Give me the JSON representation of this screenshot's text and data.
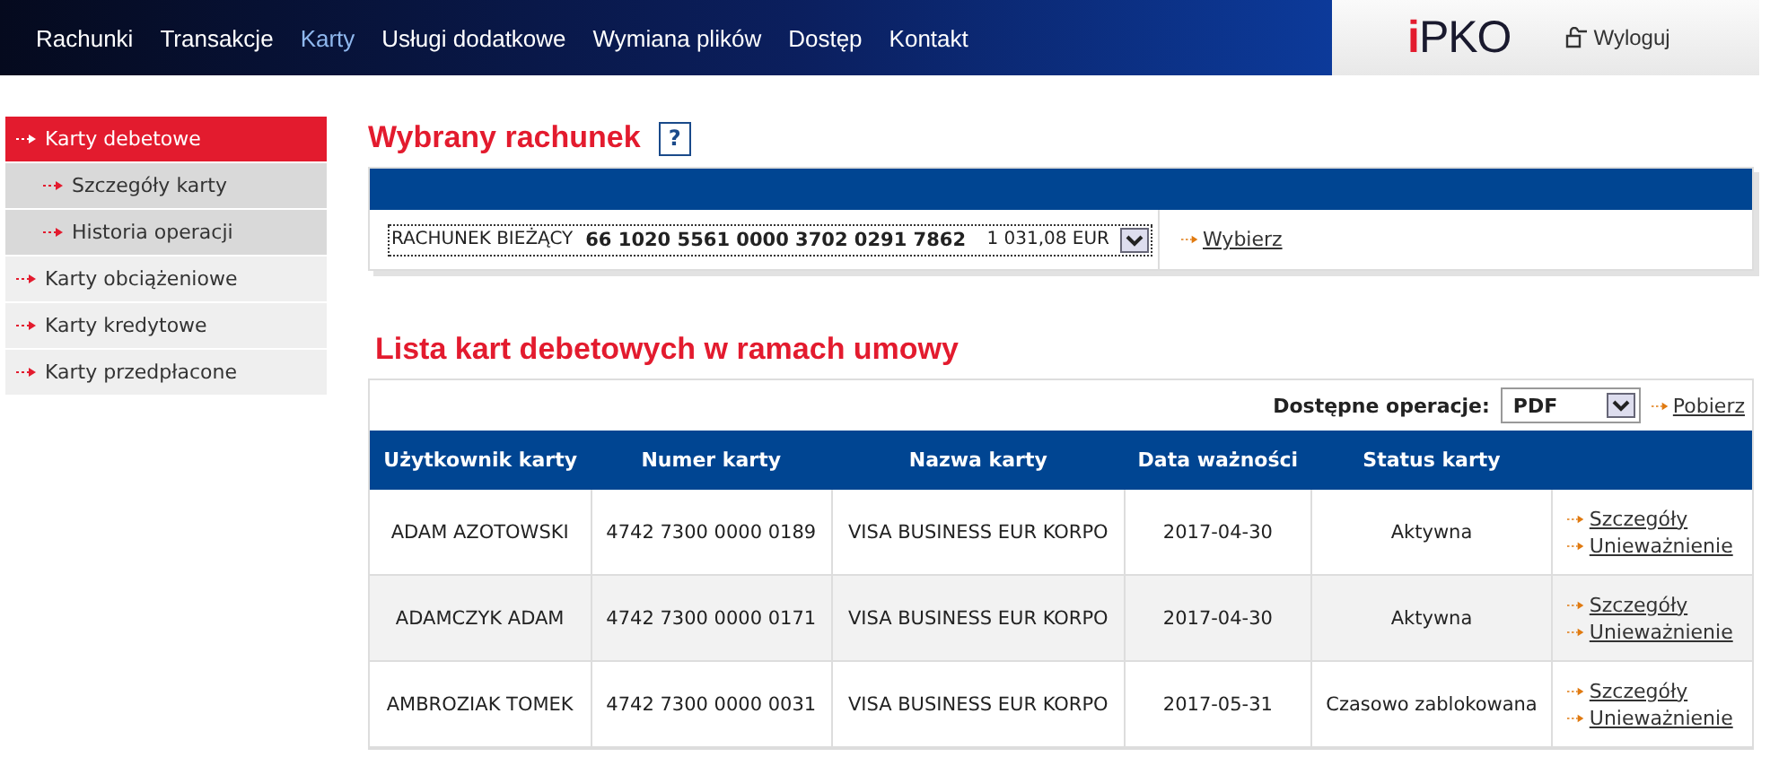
{
  "top_menu": [
    {
      "label": "Rachunki",
      "selected": false
    },
    {
      "label": "Transakcje",
      "selected": false
    },
    {
      "label": "Karty",
      "selected": true
    },
    {
      "label": "Usługi dodatkowe",
      "selected": false
    },
    {
      "label": "Wymiana plików",
      "selected": false
    },
    {
      "label": "Dostęp",
      "selected": false
    },
    {
      "label": "Kontakt",
      "selected": false
    }
  ],
  "logo": {
    "mark": "i",
    "text": "PKO"
  },
  "logout": "Wyloguj",
  "sidebar": {
    "items": [
      {
        "label": "Karty debetowe",
        "selected": true,
        "children": [
          {
            "label": "Szczegóły karty",
            "selected": false
          },
          {
            "label": "Historia operacji",
            "selected": false
          }
        ]
      },
      {
        "label": "Karty obciążeniowe",
        "selected": false
      },
      {
        "label": "Karty kredytowe",
        "selected": false
      },
      {
        "label": "Karty przedpłacone",
        "selected": false
      }
    ]
  },
  "account_section": {
    "title": "Wybrany rachunek",
    "help": "?",
    "account_type": "RACHUNEK BIEŻĄCY",
    "account_number": "66 1020 5561 0000 3702 0291 7862",
    "balance": "1 031,08 EUR",
    "select_link": "Wybierz"
  },
  "cards_section": {
    "title": "Lista kart debetowych w ramach umowy",
    "operations_label": "Dostępne operacje:",
    "operation": "PDF",
    "download_link": "Pobierz",
    "table": {
      "columns": [
        "Użytkownik karty",
        "Numer karty",
        "Nazwa karty",
        "Data ważności",
        "Status karty"
      ],
      "rows": [
        {
          "cells": [
            "ADAM AZOTOWSKI",
            "4742 7300 0000 0189",
            "VISA BUSINESS EUR KORPO",
            "2017-04-30",
            "Aktywna"
          ],
          "links": [
            "Szczegóły",
            "Unieważnienie"
          ]
        },
        {
          "cells": [
            "ADAMCZYK ADAM",
            "4742 7300 0000 0171",
            "VISA BUSINESS EUR KORPO",
            "2017-04-30",
            "Aktywna"
          ],
          "links": [
            "Szczegóły",
            "Unieważnienie"
          ]
        },
        {
          "cells": [
            "AMBROZIAK TOMEK",
            "4742 7300 0000 0031",
            "VISA BUSINESS EUR KORPO",
            "2017-05-31",
            "Czasowo zablokowana"
          ],
          "links": [
            "Szczegóły",
            "Unieważnienie"
          ]
        }
      ]
    }
  }
}
